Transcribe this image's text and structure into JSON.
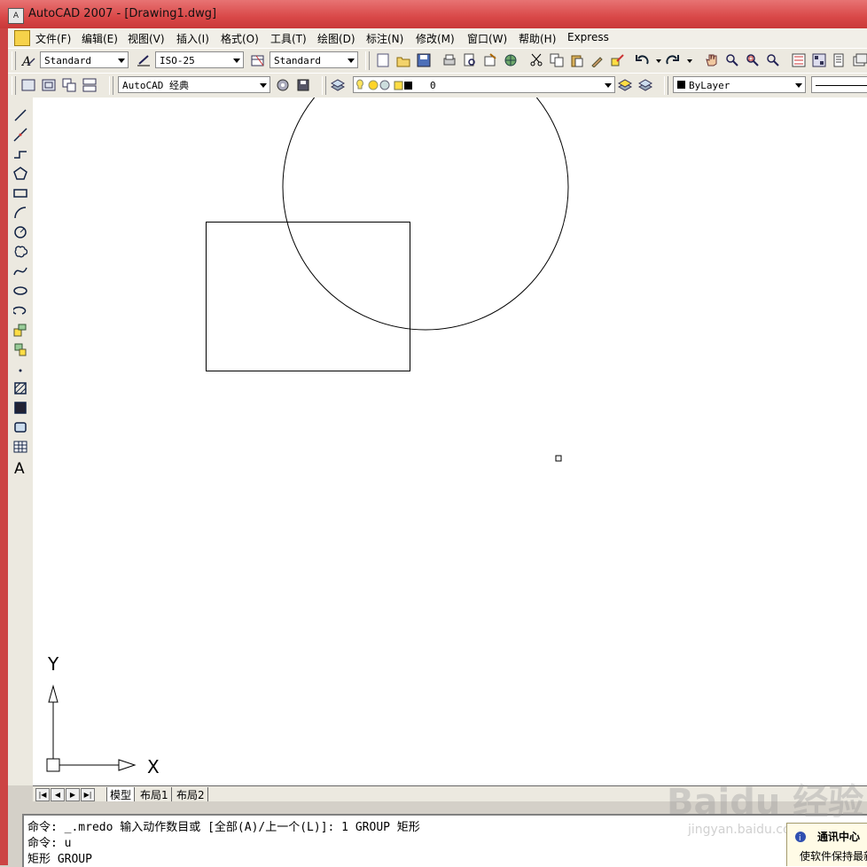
{
  "window": {
    "title": "AutoCAD 2007 - [Drawing1.dwg]",
    "app_icon_glyph": "A"
  },
  "menu": [
    "文件(F)",
    "编辑(E)",
    "视图(V)",
    "插入(I)",
    "格式(O)",
    "工具(T)",
    "绘图(D)",
    "标注(N)",
    "修改(M)",
    "窗口(W)",
    "帮助(H)",
    "Express"
  ],
  "styles_toolbar": {
    "text_style": "Standard",
    "dim_style": "ISO-25",
    "table_style": "Standard"
  },
  "workspace_toolbar": {
    "workspace": "AutoCAD 经典",
    "layer": "0",
    "color": "ByLayer"
  },
  "layout_tabs": [
    "模型",
    "布局1",
    "布局2"
  ],
  "ucs": {
    "x_label": "X",
    "y_label": "Y"
  },
  "command_history": [
    "命令: _.mredo 输入动作数目或 [全部(A)/上一个(L)]: 1 GROUP 矩形",
    "命令: u",
    "矩形 GROUP"
  ],
  "comm_center": {
    "title": "通讯中心",
    "message": "使软件保持最新"
  },
  "watermark": {
    "text": "Baidu 经验",
    "url": "jingyan.baidu.com"
  },
  "colors": {
    "title_bar": "#d94848",
    "canvas": "#ffffff",
    "toolbar": "#ece9e0"
  },
  "left_tools": [
    "line-icon",
    "construction-line-icon",
    "polyline-icon",
    "polygon-icon",
    "rectangle-icon",
    "arc-icon",
    "circle-icon",
    "revision-cloud-icon",
    "spline-icon",
    "ellipse-icon",
    "ellipse-arc-icon",
    "insert-block-icon",
    "make-block-icon",
    "point-icon",
    "hatch-icon",
    "gradient-icon",
    "region-icon",
    "table-icon",
    "multiline-text-icon"
  ]
}
